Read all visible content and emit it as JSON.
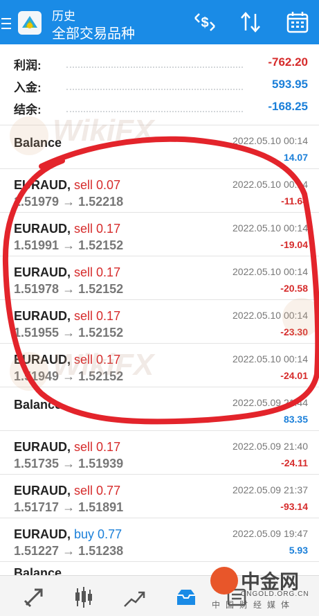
{
  "header": {
    "section": "历史",
    "title": "全部交易品种"
  },
  "summary": [
    {
      "label": "利润:",
      "value": "-762.20",
      "color": "#d62b2b"
    },
    {
      "label": "入金:",
      "value": "593.95",
      "color": "#1a7fd9"
    },
    {
      "label": "结余:",
      "value": "-168.25",
      "color": "#1a7fd9"
    }
  ],
  "deals": [
    {
      "type": "balance",
      "symbol": "Balance",
      "time": "2022.05.10 00:14",
      "profit": "14.07",
      "profit_color": "#1a7fd9"
    },
    {
      "type": "trade",
      "symbol": "EURAUD,",
      "side": "sell 0.07",
      "side_color": "#d62b2b",
      "prices": "1.51979 → 1.52218",
      "time": "2022.05.10 00:14",
      "profit": "-11.64",
      "profit_color": "#d62b2b"
    },
    {
      "type": "trade",
      "symbol": "EURAUD,",
      "side": "sell 0.17",
      "side_color": "#d62b2b",
      "prices": "1.51991 → 1.52152",
      "time": "2022.05.10 00:14",
      "profit": "-19.04",
      "profit_color": "#d62b2b"
    },
    {
      "type": "trade",
      "symbol": "EURAUD,",
      "side": "sell 0.17",
      "side_color": "#d62b2b",
      "prices": "1.51978 → 1.52152",
      "time": "2022.05.10 00:14",
      "profit": "-20.58",
      "profit_color": "#d62b2b"
    },
    {
      "type": "trade",
      "symbol": "EURAUD,",
      "side": "sell 0.17",
      "side_color": "#d62b2b",
      "prices": "1.51955 → 1.52152",
      "time": "2022.05.10 00:14",
      "profit": "-23.30",
      "profit_color": "#d62b2b"
    },
    {
      "type": "trade",
      "symbol": "EURAUD,",
      "side": "sell 0.17",
      "side_color": "#d62b2b",
      "prices": "1.51949 → 1.52152",
      "time": "2022.05.10 00:14",
      "profit": "-24.01",
      "profit_color": "#d62b2b"
    },
    {
      "type": "balance",
      "symbol": "Balance",
      "time": "2022.05.09 21:44",
      "profit": "83.35",
      "profit_color": "#1a7fd9"
    },
    {
      "type": "trade",
      "symbol": "EURAUD,",
      "side": "sell 0.17",
      "side_color": "#d62b2b",
      "prices": "1.51735 → 1.51939",
      "time": "2022.05.09 21:40",
      "profit": "-24.11",
      "profit_color": "#d62b2b"
    },
    {
      "type": "trade",
      "symbol": "EURAUD,",
      "side": "sell 0.77",
      "side_color": "#d62b2b",
      "prices": "1.51717 → 1.51891",
      "time": "2022.05.09 21:37",
      "profit": "-93.14",
      "profit_color": "#d62b2b"
    },
    {
      "type": "trade",
      "symbol": "EURAUD,",
      "side": "buy 0.77",
      "side_color": "#1a7fd9",
      "prices": "1.51227 → 1.51238",
      "time": "2022.05.09 19:47",
      "profit": "5.93",
      "profit_color": "#1a7fd9"
    },
    {
      "type": "balance-partial",
      "symbol": "Balance"
    }
  ],
  "watermark": {
    "text": "WikiFX"
  },
  "site_logo": {
    "cn": "中金网",
    "en": "CNGOLD.ORG.CN",
    "sub": "中国财经媒体"
  },
  "icons": {
    "menu": "menu-icon",
    "logo": "app-logo-icon",
    "currency": "currency-switch-icon",
    "sort": "sort-icon",
    "calendar": "calendar-icon",
    "nav": [
      "quotes-icon",
      "chart-icon",
      "trade-icon",
      "history-icon",
      "messages-icon"
    ]
  },
  "colors": {
    "accent": "#1a8be6",
    "loss": "#d62b2b",
    "profit": "#1a7fd9",
    "annotation": "#e3242b"
  }
}
